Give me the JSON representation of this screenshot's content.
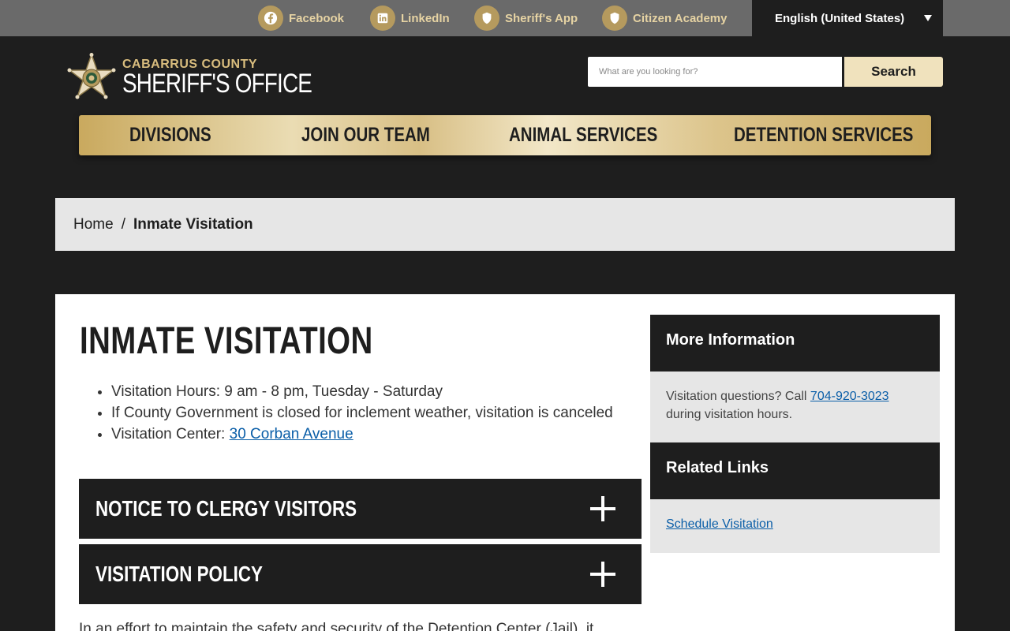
{
  "topbar": {
    "links": [
      {
        "label": "Facebook",
        "icon": "facebook-icon"
      },
      {
        "label": "LinkedIn",
        "icon": "linkedin-icon"
      },
      {
        "label": "Sheriff's App",
        "icon": "shield-icon"
      },
      {
        "label": "Citizen Academy",
        "icon": "shield-icon"
      }
    ],
    "language": "English (United States)"
  },
  "header": {
    "logo_line1": "CABARRUS COUNTY",
    "logo_line2": "SHERIFF'S OFFICE",
    "search_placeholder": "What are you looking for?",
    "search_button": "Search"
  },
  "nav": {
    "items": [
      "DIVISIONS",
      "JOIN OUR TEAM",
      "ANIMAL SERVICES",
      "DETENTION SERVICES"
    ]
  },
  "breadcrumb": {
    "home": "Home",
    "separator": "/",
    "current": "Inmate Visitation"
  },
  "main": {
    "title": "INMATE VISITATION",
    "bullets": {
      "hours": "Visitation Hours: 9 am - 8 pm, Tuesday - Saturday",
      "weather": "If County Government is closed for inclement weather, visitation is canceled",
      "center_prefix": "Visitation Center: ",
      "center_link": "30 Corban Avenue"
    },
    "accordions": [
      "NOTICE TO CLERGY VISITORS",
      "VISITATION POLICY"
    ],
    "paragraph": "In an effort to maintain the safety and security of the Detention Center (Jail), it"
  },
  "sidebar": {
    "more_info_title": "More Information",
    "more_info_prefix": "Visitation questions? Call ",
    "more_info_phone": "704-920-3023",
    "more_info_suffix": " during visitation hours.",
    "related_title": "Related Links",
    "related_link": "Schedule Visitation"
  },
  "colors": {
    "gold": "#b59a5e",
    "gold_light": "#f0e2bd",
    "dark": "#1e1e1e",
    "link": "#0a5ea8"
  }
}
